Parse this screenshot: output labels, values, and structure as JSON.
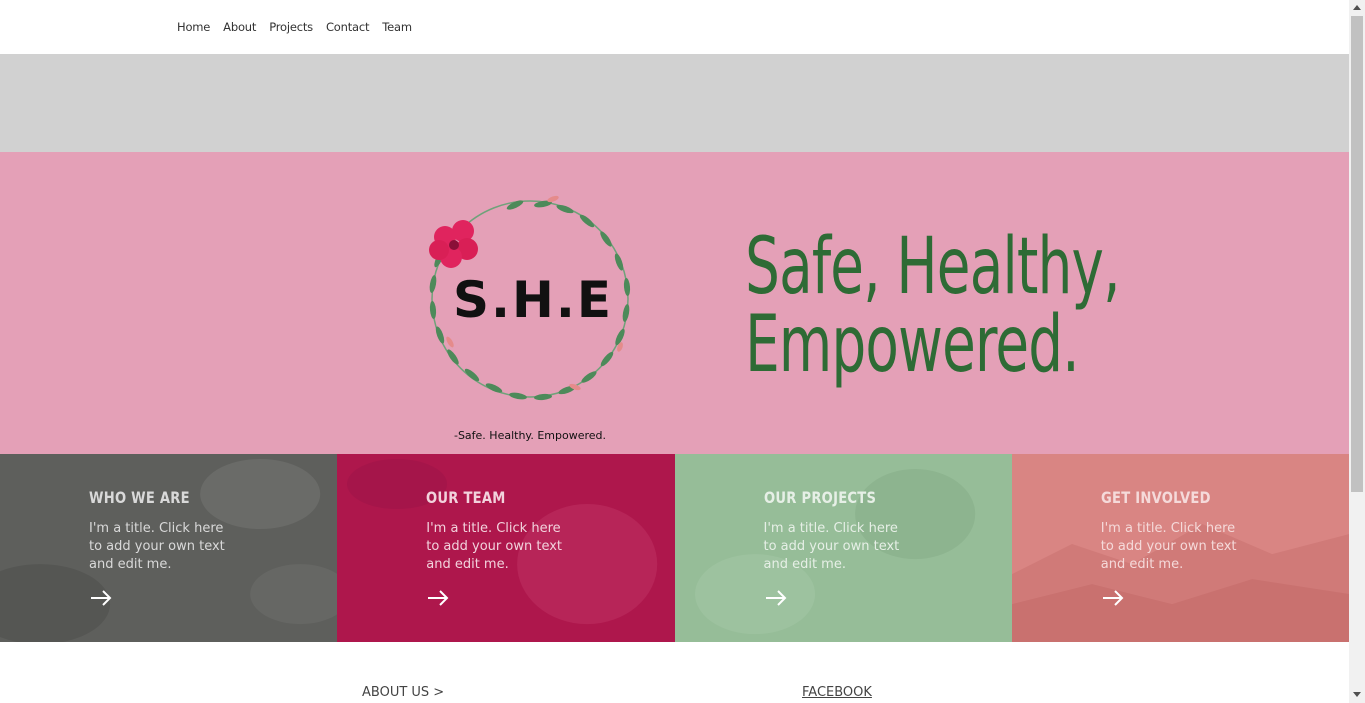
{
  "nav": {
    "items": [
      "Home",
      "About",
      "Projects",
      "Contact",
      "Team"
    ]
  },
  "hero": {
    "logo_text": "S.H.E",
    "logo_caption": "-Safe. Healthy. Empowered.",
    "tagline_line1": "Safe, Healthy,",
    "tagline_line2": "Empowered."
  },
  "tiles": [
    {
      "title": "WHO WE ARE",
      "body": "I'm a title. Click here to add your own text and edit me.",
      "bg": "#5e5f5c",
      "title_color": "#d9d9d9",
      "text_color": "#d9d9d9"
    },
    {
      "title": "OUR TEAM",
      "body": "I'm a title. Click here to add your own text and edit me.",
      "bg": "#ae174c",
      "title_color": "#f2d2dc",
      "text_color": "#f2d2dc"
    },
    {
      "title": "OUR PROJECTS",
      "body": "I'm a title. Click here to add your own text and edit me.",
      "bg": "#96bd98",
      "title_color": "#e6efe6",
      "text_color": "#e6efe6"
    },
    {
      "title": "GET INVOLVED",
      "body": "I'm a title. Click here to add your own text and edit me.",
      "bg": "#d98583",
      "title_color": "#f5dada",
      "text_color": "#f5dada"
    }
  ],
  "footer": {
    "about_label": "ABOUT US >",
    "facebook_label": "FACEBOOK"
  },
  "colors": {
    "hero_bg": "#e4a0b7",
    "tagline": "#2e6b35",
    "grey_band": "#d1d1d1"
  }
}
